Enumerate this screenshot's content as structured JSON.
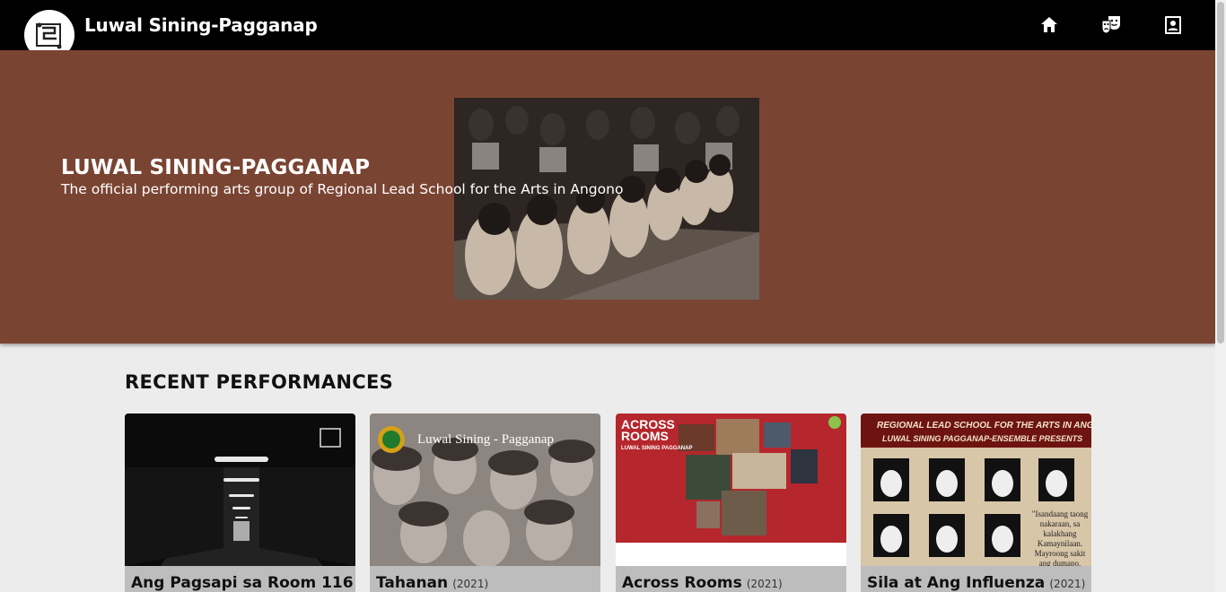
{
  "app": {
    "title": "Luwal Sining-Pagganap"
  },
  "nav": [
    {
      "name": "home-icon"
    },
    {
      "name": "theater-masks-icon"
    },
    {
      "name": "contact-card-icon"
    }
  ],
  "hero": {
    "title": "LUWAL SINING-PAGGANAP",
    "subtitle": "The official performing arts group of Regional Lead School for the Arts in Angono"
  },
  "recent": {
    "heading": "RECENT PERFORMANCES",
    "cards": [
      {
        "title": "Ang Pagsapi sa Room 116",
        "year": ""
      },
      {
        "title": "Tahanan",
        "year": "(2021)"
      },
      {
        "title": "Across Rooms",
        "year": "(2021)"
      },
      {
        "title": "Sila at Ang Influenza",
        "year": "(2021)"
      }
    ]
  },
  "posters": {
    "card2_banner": "Luwal Sining - Pagganap",
    "card3_title": "ACROSS ROOMS",
    "card3_sub": "LUWAL SINING PAGGANAP",
    "card4_top": "REGIONAL LEAD SCHOOL FOR THE ARTS IN ANGONO",
    "card4_sub": "LUWAL SINING PAGGANAP-ENSEMBLE PRESENTS",
    "card4_quote": "\"Isandaang taong nakaraan, sa kalakhang Kamaynilaan. Mayroong sakit ang dumapo,"
  },
  "colors": {
    "appbar": "#000000",
    "hero": "#7a4432",
    "page": "#ececec",
    "card_caption": "#bdbdbd"
  }
}
